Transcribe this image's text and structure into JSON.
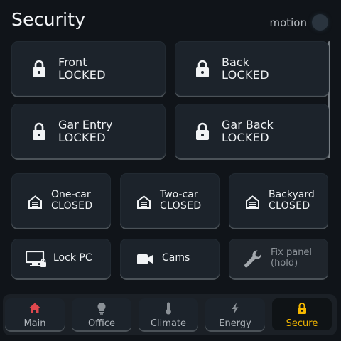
{
  "header": {
    "title": "Security",
    "motion_label": "motion"
  },
  "locks": [
    {
      "name": "Front",
      "state": "LOCKED",
      "icon": "lock-icon"
    },
    {
      "name": "Back",
      "state": "LOCKED",
      "icon": "lock-icon"
    },
    {
      "name": "Gar Entry",
      "state": "LOCKED",
      "icon": "lock-icon"
    },
    {
      "name": "Gar Back",
      "state": "LOCKED",
      "icon": "lock-icon"
    }
  ],
  "garages": [
    {
      "name": "One-car",
      "state": "CLOSED",
      "icon": "garage-icon"
    },
    {
      "name": "Two-car",
      "state": "CLOSED",
      "icon": "garage-icon"
    },
    {
      "name": "Backyard",
      "state": "CLOSED",
      "icon": "garage-icon"
    }
  ],
  "actions": {
    "lock_pc": {
      "label": "Lock PC",
      "icon": "computer-lock-icon"
    },
    "cams": {
      "label": "Cams",
      "icon": "video-camera-icon"
    },
    "fix_panel": {
      "label_line1": "Fix panel",
      "label_line2": "(hold)",
      "icon": "wrench-icon"
    }
  },
  "nav": [
    {
      "label": "Main",
      "icon": "home-icon",
      "color": "#e0484e"
    },
    {
      "label": "Office",
      "icon": "lightbulb-icon",
      "color": "#8b9197"
    },
    {
      "label": "Climate",
      "icon": "thermometer-icon",
      "color": "#8b9197"
    },
    {
      "label": "Energy",
      "icon": "lightning-icon",
      "color": "#8b9197"
    },
    {
      "label": "Secure",
      "icon": "lock-icon",
      "color": "#f5b800",
      "active": true
    }
  ],
  "colors": {
    "background": "#101419",
    "card": "#1c232b",
    "accent": "#f5b800",
    "home": "#e0484e"
  }
}
